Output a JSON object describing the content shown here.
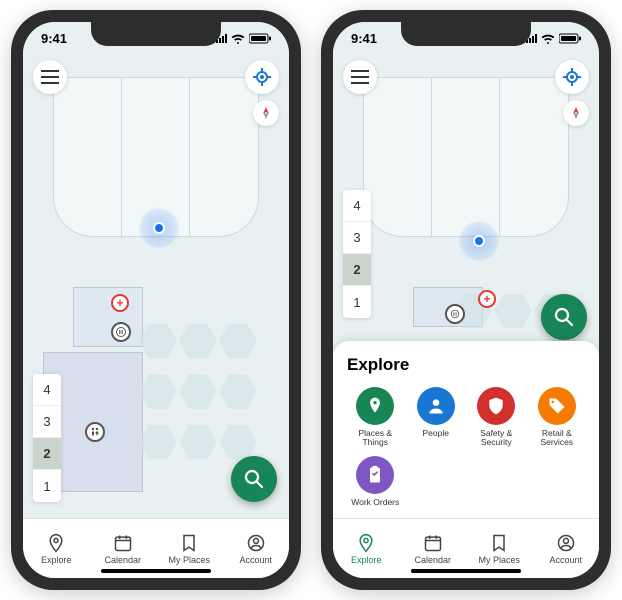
{
  "status": {
    "time": "9:41"
  },
  "floors": {
    "levels": [
      "4",
      "3",
      "2",
      "1"
    ],
    "active": "2"
  },
  "nav": {
    "items": [
      {
        "label": "Explore"
      },
      {
        "label": "Calendar"
      },
      {
        "label": "My Places"
      },
      {
        "label": "Account"
      }
    ],
    "active_left": 0,
    "active_right": 0
  },
  "sheet": {
    "title": "Explore",
    "categories": [
      {
        "label": "Places & Things",
        "color": "#188554"
      },
      {
        "label": "People",
        "color": "#1976d2"
      },
      {
        "label": "Safety & Security",
        "color": "#d32f2f"
      },
      {
        "label": "Retail & Services",
        "color": "#f57c00"
      },
      {
        "label": "Work Orders",
        "color": "#7e57c2"
      }
    ]
  },
  "icons": {
    "menu": "menu-icon",
    "locate": "locate-icon",
    "compass": "compass-icon",
    "search": "search-icon",
    "medical": "medical-icon",
    "restroom": "restroom-icon",
    "location": "location-dot-icon"
  },
  "colors": {
    "accent": "#188554",
    "location": "#1a73e8"
  }
}
